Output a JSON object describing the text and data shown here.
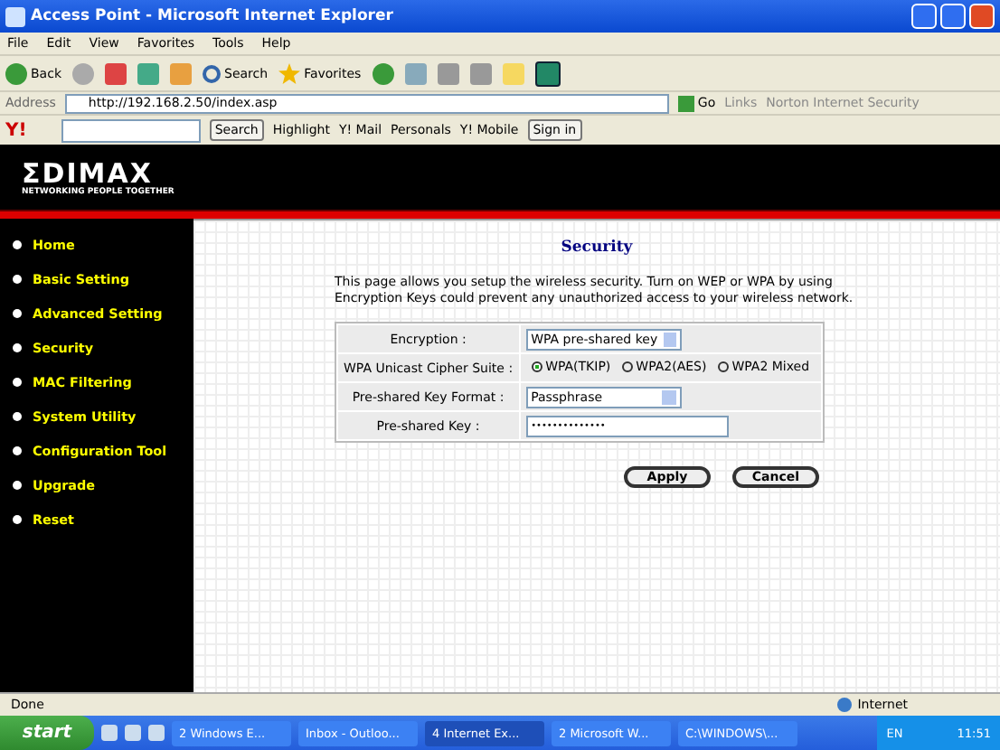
{
  "window": {
    "title": "Access Point - Microsoft Internet Explorer"
  },
  "menu": [
    "File",
    "Edit",
    "View",
    "Favorites",
    "Tools",
    "Help"
  ],
  "toolbar": {
    "back": "Back",
    "search": "Search",
    "favorites": "Favorites"
  },
  "address": {
    "label": "Address",
    "url": "http://192.168.2.50/index.asp",
    "go": "Go",
    "links": "Links",
    "norton": "Norton Internet Security"
  },
  "yahoo_bar": {
    "logo": "Y!",
    "search": "Search",
    "highlight": "Highlight",
    "mail": "Y! Mail",
    "personals": "Personals",
    "mobile": "Y! Mobile",
    "sign_in": "Sign in"
  },
  "brand": {
    "name": "ΣDIMAX",
    "tagline": "NETWORKING PEOPLE TOGETHER"
  },
  "sidebar": {
    "items": [
      {
        "label": "Home",
        "selected": false
      },
      {
        "label": "Basic Setting",
        "selected": false
      },
      {
        "label": "Advanced Setting",
        "selected": false
      },
      {
        "label": "Security",
        "selected": false
      },
      {
        "label": "MAC Filtering",
        "selected": false
      },
      {
        "label": "System Utility",
        "selected": false
      },
      {
        "label": "Configuration Tool",
        "selected": false
      },
      {
        "label": "Upgrade",
        "selected": false
      },
      {
        "label": "Reset",
        "selected": false
      }
    ]
  },
  "page": {
    "title": "Security",
    "description": "This page allows you setup the wireless security. Turn on WEP or WPA by using Encryption Keys could prevent any unauthorized access to your wireless network."
  },
  "form": [
    {
      "kind": "select",
      "label": "Encryption :",
      "value": "WPA pre-shared key"
    },
    {
      "kind": "radio",
      "label": "WPA Unicast Cipher Suite :",
      "options": [
        {
          "label": "WPA(TKIP)",
          "selected": true
        },
        {
          "label": "WPA2(AES)",
          "selected": false
        },
        {
          "label": "WPA2 Mixed",
          "selected": false
        }
      ]
    },
    {
      "kind": "select",
      "label": "Pre-shared Key Format :",
      "value": "Passphrase"
    },
    {
      "kind": "password",
      "label": "Pre-shared Key :",
      "value": "••••••••••••••"
    }
  ],
  "buttons": [
    "Apply",
    "Cancel"
  ],
  "status_bar": {
    "text": "Done",
    "zone": "Internet"
  },
  "taskbar": {
    "start": "start",
    "tasks": [
      {
        "label": "2 Windows E...",
        "selected": false
      },
      {
        "label": "Inbox - Outloo...",
        "selected": false
      },
      {
        "label": "4 Internet Ex...",
        "selected": true
      },
      {
        "label": "2 Microsoft W...",
        "selected": false
      },
      {
        "label": "C:\\WINDOWS\\...",
        "selected": false
      }
    ],
    "lang": "EN",
    "clock": "11:51"
  }
}
